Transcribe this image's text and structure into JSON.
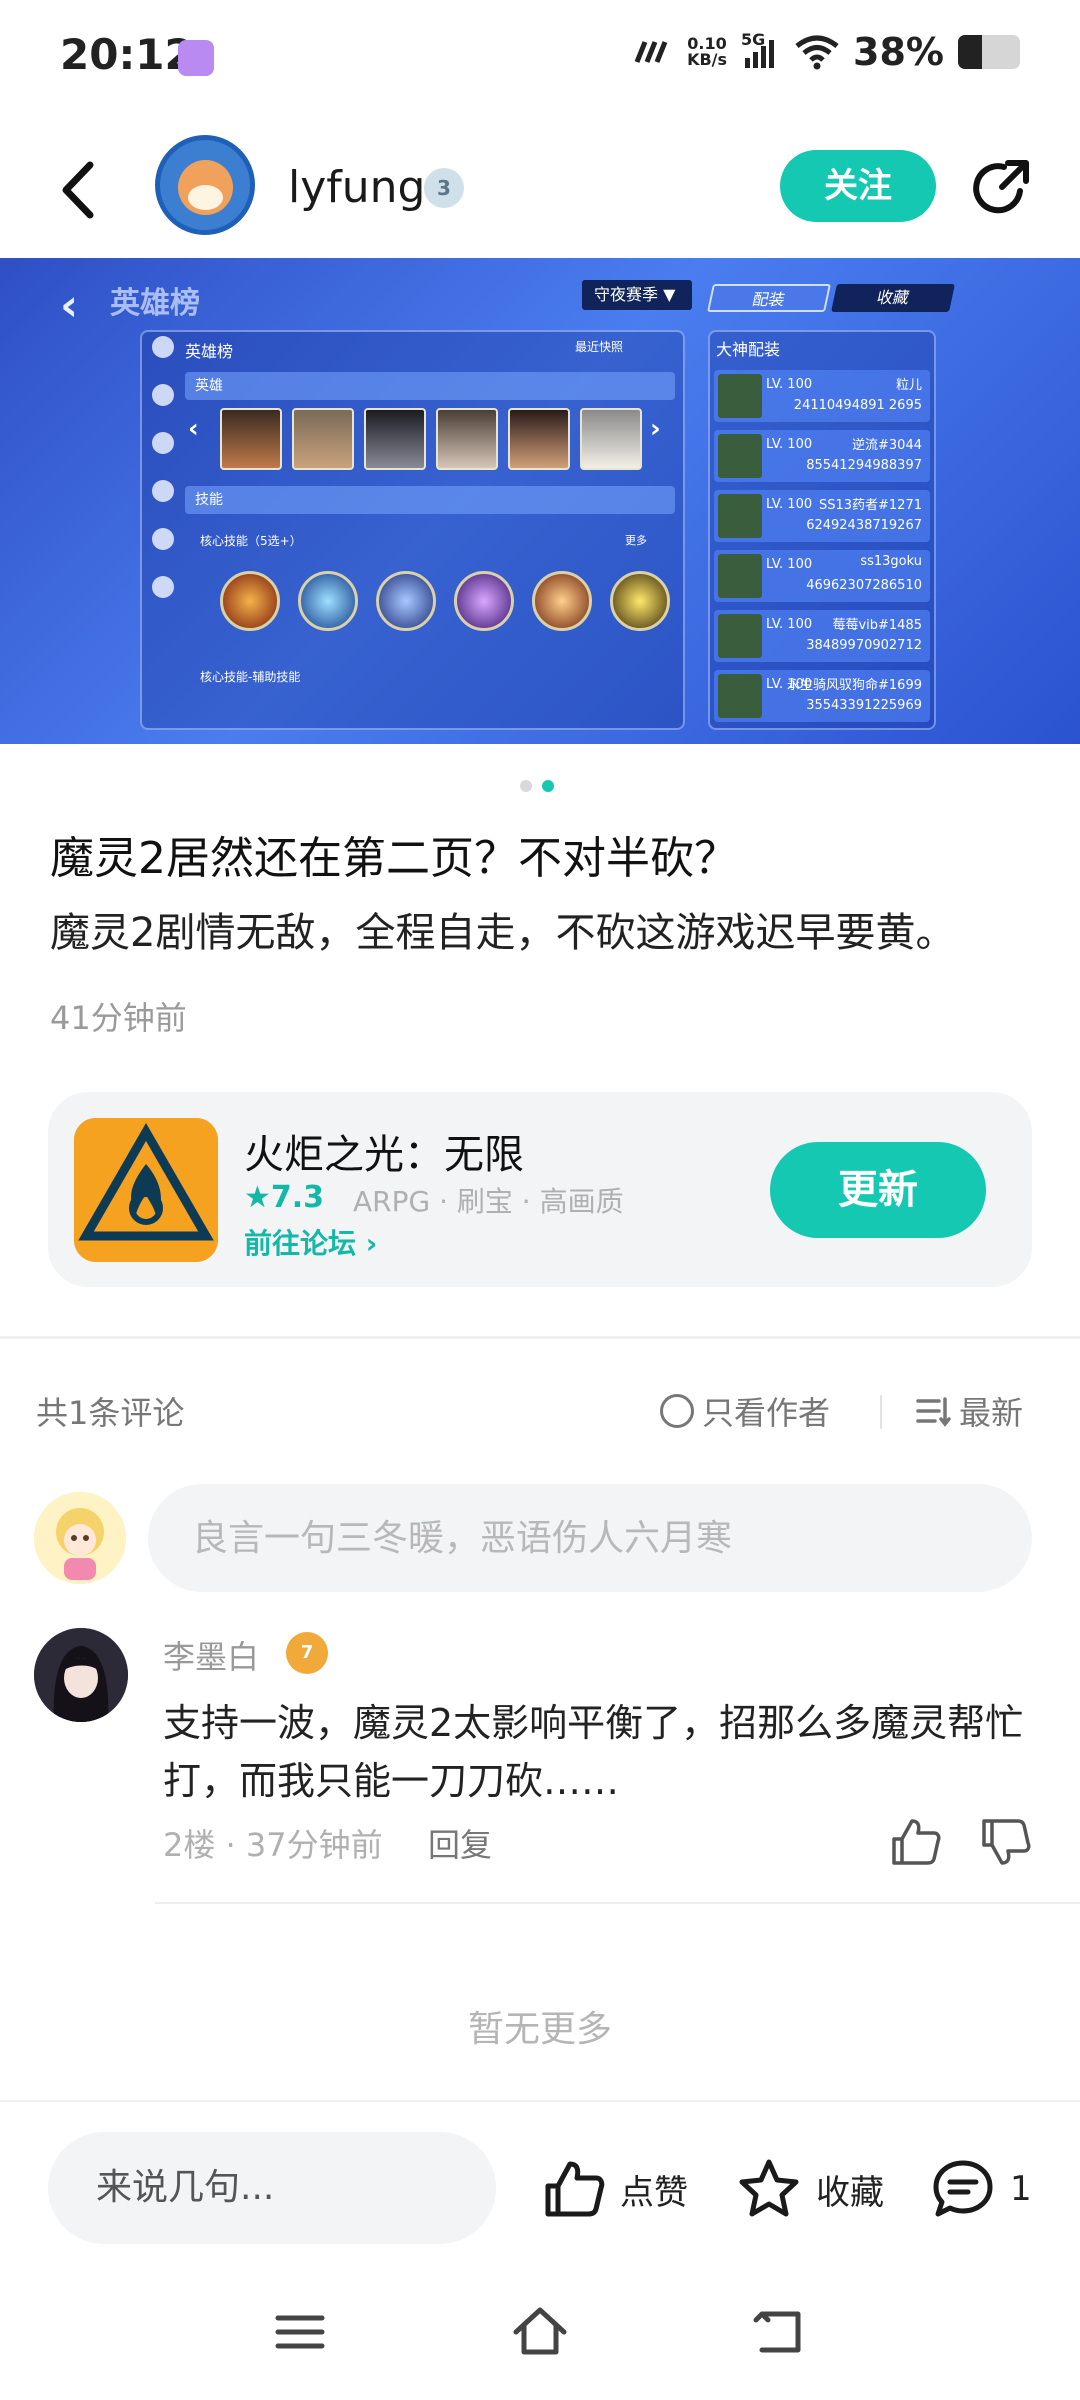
{
  "status_bar": {
    "time": "20:12",
    "network_speed": "0.10",
    "network_unit": "KB/s",
    "signal_label": "5G",
    "battery_percent": "38%",
    "battery_level": 0.38,
    "icons": [
      "app-notification-icon",
      "carrier-icon",
      "signal-icon",
      "wifi-icon",
      "battery-icon"
    ]
  },
  "header": {
    "username": "lyfung",
    "level_badge": "3",
    "follow_label": "关注"
  },
  "banner": {
    "page_count": 2,
    "active_page": 2,
    "image_texts": {
      "title": "英雄榜",
      "season": "守夜赛季",
      "tab_loadout": "配装",
      "tab_favorite": "收藏",
      "panel_title": "英雄榜",
      "recent_snapshot": "最近快照",
      "heroes_label": "英雄",
      "skills_label": "技能",
      "core_skills": "核心技能（5选+）",
      "core_skills_aux": "核心技能-辅助技能",
      "more": "更多",
      "right_title": "大神配装",
      "players": [
        {
          "lv": "LV. 100",
          "name": "粒儿",
          "id": "24110494891 2695"
        },
        {
          "lv": "LV. 100",
          "name": "逆流#3044",
          "id": "85541294988397"
        },
        {
          "lv": "LV. 100",
          "name": "SS13药者#1271",
          "id": "62492438719267"
        },
        {
          "lv": "LV. 100",
          "name": "ss13goku",
          "id": "46962307286510"
        },
        {
          "lv": "LV. 100",
          "name": "莓莓vib#1485",
          "id": "38489970902712"
        },
        {
          "lv": "LV. 100",
          "name": "永生骑风驭狗命#1699",
          "id": "35543391225969"
        }
      ]
    }
  },
  "post": {
    "title": "魔灵2居然还在第二页？不对半砍？",
    "body": "魔灵2剧情无敌，全程自走，不砍这游戏迟早要黄。",
    "time": "41分钟前"
  },
  "game_card": {
    "name": "火炬之光：无限",
    "rating": "7.3",
    "tags": "ARPG · 刷宝 · 高画质",
    "forum_link": "前往论坛",
    "update_label": "更新"
  },
  "comments_toolbar": {
    "count_text": "共1条评论",
    "author_only": "只看作者",
    "sort_label": "最新"
  },
  "comment_input": {
    "placeholder": "良言一句三冬暖，恶语伤人六月寒"
  },
  "comments": [
    {
      "author": "李墨白",
      "badge": "7",
      "text": "支持一波，魔灵2太影响平衡了，招那么多魔灵帮忙打，而我只能一刀刀砍……",
      "meta": "2楼 · 37分钟前",
      "reply_label": "回复"
    }
  ],
  "no_more_text": "暂无更多",
  "bottom_bar": {
    "input_placeholder": "来说几句...",
    "like_label": "点赞",
    "favorite_label": "收藏",
    "comment_count": "1"
  },
  "colors": {
    "accent": "#14c8b2",
    "accent_text": "#14b8a6",
    "muted_text": "#999999",
    "card_bg": "#f2f4f6"
  }
}
